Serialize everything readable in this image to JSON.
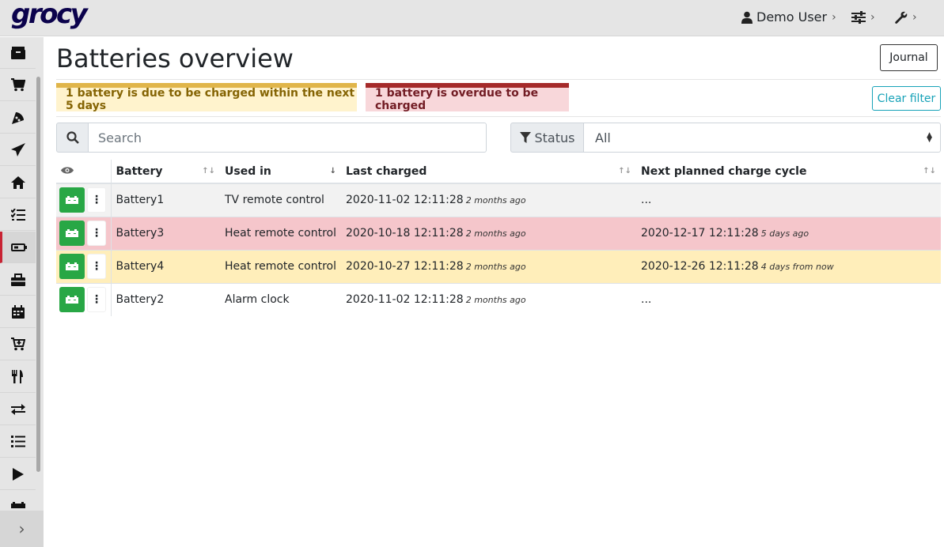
{
  "app": {
    "logo": "grocy"
  },
  "topnav": {
    "user": "Demo User"
  },
  "page": {
    "title": "Batteries overview",
    "journal_label": "Journal",
    "clear_filter_label": "Clear filter"
  },
  "alerts": {
    "due_soon": "1 battery is due to be charged within the next 5 days",
    "overdue": "1 battery is overdue to be charged"
  },
  "search": {
    "placeholder": "Search"
  },
  "status_filter": {
    "label": "Status",
    "value": "All"
  },
  "table": {
    "headers": {
      "battery": "Battery",
      "used_in": "Used in",
      "last_charged": "Last charged",
      "next_cycle": "Next planned charge cycle"
    },
    "rows": [
      {
        "battery": "Battery1",
        "used_in": "TV remote control",
        "last_charged": "2020-11-02 12:11:28",
        "last_rel": "2 months ago",
        "next": "...",
        "next_rel": ""
      },
      {
        "battery": "Battery3",
        "used_in": "Heat remote control",
        "last_charged": "2020-10-18 12:11:28",
        "last_rel": "2 months ago",
        "next": "2020-12-17 12:11:28",
        "next_rel": "5 days ago"
      },
      {
        "battery": "Battery4",
        "used_in": "Heat remote control",
        "last_charged": "2020-10-27 12:11:28",
        "last_rel": "2 months ago",
        "next": "2020-12-26 12:11:28",
        "next_rel": "4 days from now"
      },
      {
        "battery": "Battery2",
        "used_in": "Alarm clock",
        "last_charged": "2020-11-02 12:11:28",
        "last_rel": "2 months ago",
        "next": "...",
        "next_rel": ""
      }
    ]
  },
  "colors": {
    "brand": "#0b024c",
    "success": "#28a745",
    "danger_row": "#f5c6cb",
    "warning_row": "#ffeeba",
    "active_marker": "#c82333"
  },
  "sidebar_icons": [
    "box-icon",
    "cart-icon",
    "rss-icon",
    "paper-plane-icon",
    "home-icon",
    "tasks-icon",
    "battery-icon",
    "toolbox-icon",
    "calendar-icon",
    "cart-plus-icon",
    "utensils-icon",
    "exchange-icon",
    "list-icon",
    "play-icon",
    "more-icon"
  ]
}
